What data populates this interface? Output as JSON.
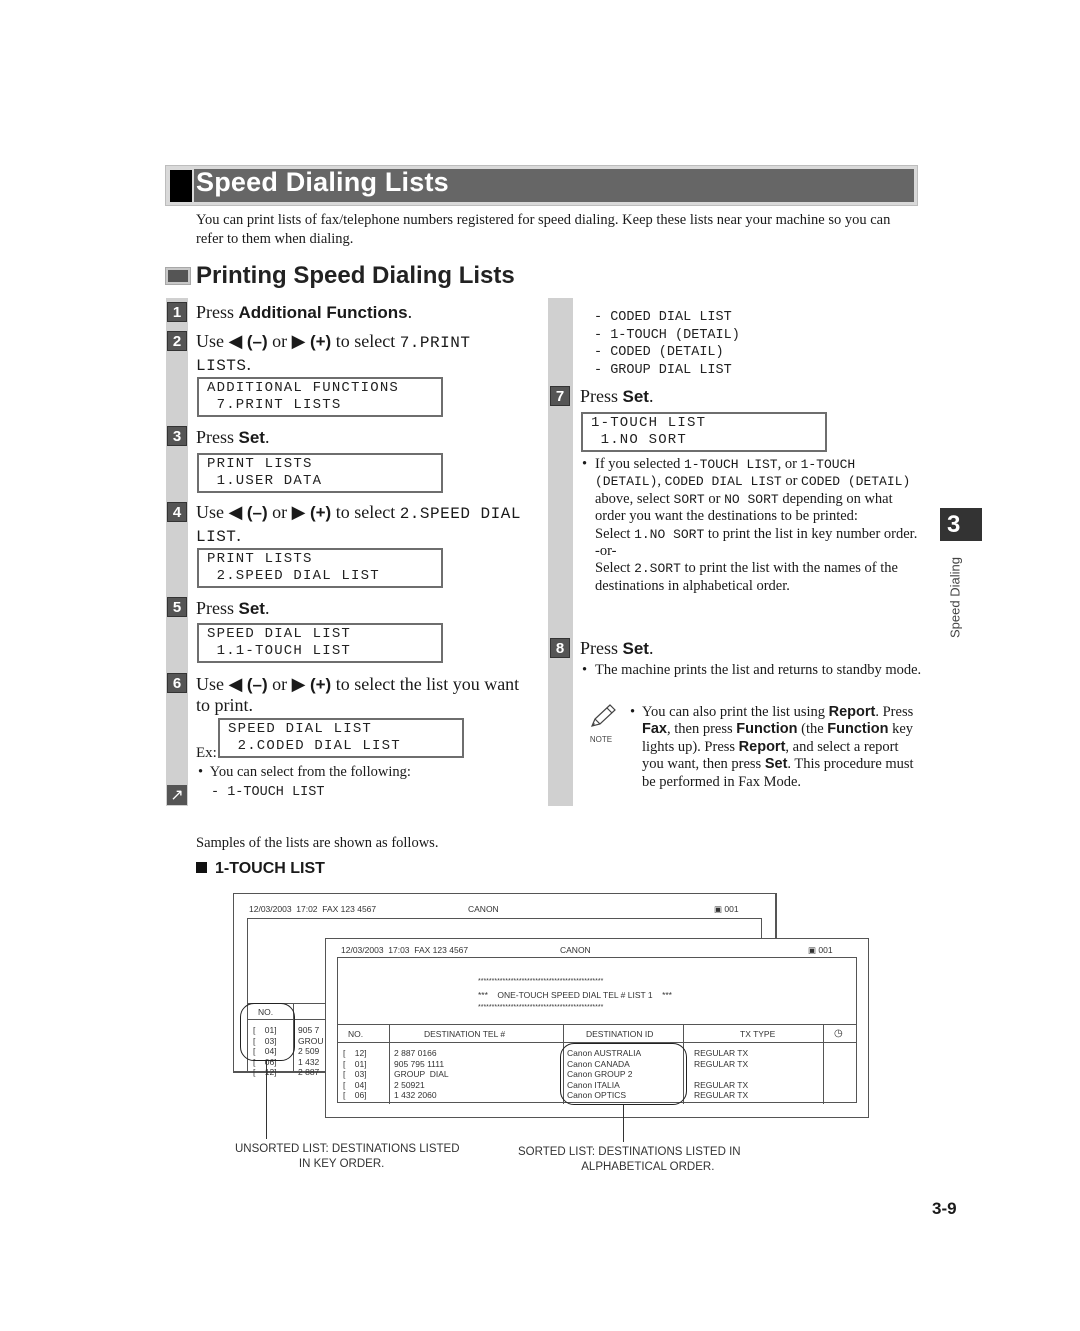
{
  "title": "Speed Dialing Lists",
  "intro": "You can print lists of fax/telephone numbers registered for speed dialing. Keep these lists near your machine so you can refer to them when dialing.",
  "section_title": "Printing Speed Dialing Lists",
  "steps": [
    {
      "num": "1",
      "pre": "Press ",
      "bold": "Additional Functions",
      "post": "."
    },
    {
      "num": "2",
      "pre": "Use ",
      "arrow_left": "◀",
      "minus": "(–)",
      "or": " or ",
      "arrow_right": "▶",
      "plus": "(+)",
      "mid": " to select ",
      "mono": "7.PRINT LISTS",
      "post": ".",
      "lcd": [
        "ADDITIONAL FUNCTIONS",
        " 7.PRINT LISTS"
      ]
    },
    {
      "num": "3",
      "pre": "Press ",
      "bold": "Set",
      "post": ".",
      "lcd": [
        "PRINT LISTS",
        " 1.USER DATA"
      ]
    },
    {
      "num": "4",
      "pre": "Use ",
      "arrow_left": "◀",
      "minus": "(–)",
      "or": " or ",
      "arrow_right": "▶",
      "plus": "(+)",
      "mid": " to select ",
      "mono": "2.SPEED DIAL LIST",
      "post": ".",
      "lcd": [
        "PRINT LISTS",
        " 2.SPEED DIAL LIST"
      ]
    },
    {
      "num": "5",
      "pre": "Press ",
      "bold": "Set",
      "post": ".",
      "lcd": [
        "SPEED DIAL LIST",
        " 1.1-TOUCH LIST"
      ]
    },
    {
      "num": "6",
      "pre": "Use ",
      "arrow_left": "◀",
      "minus": "(–)",
      "or": " or ",
      "arrow_right": "▶",
      "plus": "(+)",
      "mid": " to select the list you want to print.",
      "ex_label": "Ex:",
      "lcd": [
        "SPEED DIAL LIST",
        " 2.CODED DIAL LIST"
      ],
      "bullet": "You can select from the following:",
      "options": [
        "- 1-TOUCH LIST",
        "- CODED DIAL LIST",
        "- 1-TOUCH (DETAIL)",
        "- CODED (DETAIL)",
        "- GROUP DIAL LIST"
      ]
    },
    {
      "num": "7",
      "pre": "Press ",
      "bold": "Set",
      "post": ".",
      "lcd": [
        "1-TOUCH LIST",
        " 1.NO SORT"
      ],
      "bullet_parts": {
        "a": "If you selected ",
        "m1": "1-TOUCH LIST",
        "b": ", or ",
        "m2": "1-TOUCH (DETAIL)",
        "c": ", ",
        "m3": "CODED DIAL LIST",
        "d": " or ",
        "m4": "CODED (DETAIL)",
        "e": " above, select ",
        "m5": "SORT",
        "f": " or ",
        "m6": "NO SORT",
        "g": " depending on what order you want the destinations to be printed:",
        "sel1_pre": "Select ",
        "sel1_m": "1.NO SORT",
        "sel1_post": " to print the list in key number order.",
        "or": "-or-",
        "sel2_pre": "Select ",
        "sel2_m": "2.SORT",
        "sel2_post": " to print the list with the names of the destinations in alphabetical order."
      }
    },
    {
      "num": "8",
      "pre": "Press ",
      "bold": "Set",
      "post": ".",
      "bullet": "The machine prints the list and returns to standby mode."
    }
  ],
  "note": {
    "label": "NOTE",
    "t1": "You can also print the list using ",
    "b1": "Report",
    "t2": ". Press ",
    "b2": "Fax",
    "t3": ", then press ",
    "b3": "Function",
    "t4": " (the ",
    "b4": "Function",
    "t5": " key lights up). Press ",
    "b5": "Report",
    "t6": ", and select a report you want, then press ",
    "b6": "Set",
    "t7": ". This procedure must be performed in Fax Mode."
  },
  "chapter_tab": {
    "number": "3",
    "label": "Speed Dialing"
  },
  "samples_text": "Samples of the lists are shown as follows.",
  "list_heading": "1-TOUCH LIST",
  "report_back": {
    "header": "12/03/2003  17:02  FAX 123 4567",
    "company": "CANON",
    "page": "001",
    "col_no": "NO.",
    "rows": [
      {
        "no": "[    01]",
        "tel": "905 7"
      },
      {
        "no": "[    03]",
        "tel": "GROU"
      },
      {
        "no": "[    04]",
        "tel": "2 509"
      },
      {
        "no": "[    06]",
        "tel": "1 432"
      },
      {
        "no": "[    12]",
        "tel": "2 887"
      }
    ]
  },
  "report_front": {
    "header": "12/03/2003  17:03  FAX 123 4567",
    "company": "CANON",
    "page": "001",
    "stars": "**********************************************",
    "banner": "***    ONE-TOUCH SPEED DIAL TEL # LIST 1    ***",
    "columns": [
      "NO.",
      "DESTINATION TEL #",
      "DESTINATION ID",
      "TX TYPE"
    ],
    "rows": [
      {
        "no": "[    12]",
        "tel": "2 887 0166",
        "id": "Canon AUSTRALIA",
        "tx": "REGULAR TX"
      },
      {
        "no": "[    01]",
        "tel": "905 795 1111",
        "id": "Canon CANADA",
        "tx": "REGULAR TX"
      },
      {
        "no": "[    03]",
        "tel": "GROUP  DIAL",
        "id": "Canon GROUP 2",
        "tx": ""
      },
      {
        "no": "[    04]",
        "tel": "2 50921",
        "id": "Canon ITALIA",
        "tx": "REGULAR TX"
      },
      {
        "no": "[    06]",
        "tel": "1 432 2060",
        "id": "Canon OPTICS",
        "tx": "REGULAR TX"
      }
    ]
  },
  "captions": {
    "unsorted": "UNSORTED LIST: DESTINATIONS LISTED\n                    IN KEY ORDER.",
    "sorted": "SORTED LIST: DESTINATIONS LISTED IN\n                    ALPHABETICAL ORDER."
  },
  "page_number": "3-9"
}
